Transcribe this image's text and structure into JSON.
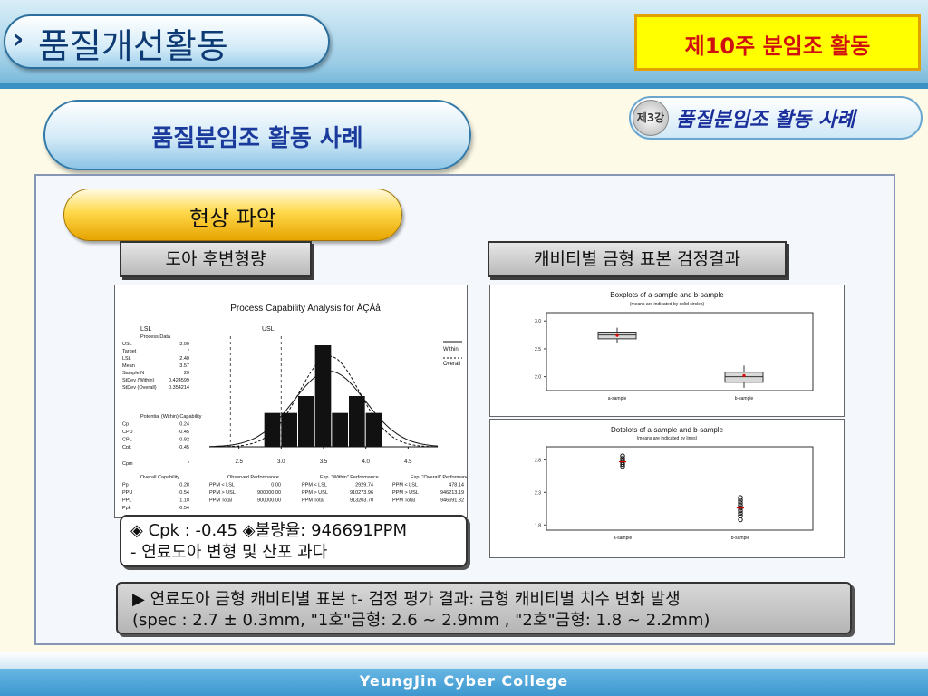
{
  "header": {
    "title": "품질개선활동",
    "week_label": "제10주 분임조 활동"
  },
  "section_title": "품질분임조 활동 사례",
  "lesson": {
    "badge": "제3강",
    "title": "품질분임조 활동 사례"
  },
  "phase_title": "현상 파악",
  "door_label": "도아 후변형량",
  "cavity_label": "캐비티별 금형 표본 검정결과",
  "capability": {
    "title": "Process Capability Analysis for ÀÇÅå",
    "lsl_label": "LSL",
    "usl_label": "USL",
    "legend_within": "Within",
    "legend_overall": "Overall",
    "process_header": "Process Data",
    "process_rows": [
      {
        "k": "USL",
        "v": "3.00"
      },
      {
        "k": "Target",
        "v": "*"
      },
      {
        "k": "LSL",
        "v": "2.40"
      },
      {
        "k": "Mean",
        "v": "3.57"
      },
      {
        "k": "Sample N",
        "v": "20"
      },
      {
        "k": "StDev (Within)",
        "v": "0.424599"
      },
      {
        "k": "StDev (Overall)",
        "v": "0.354214"
      }
    ],
    "potential_header": "Potential (Within) Capability",
    "potential_rows": [
      {
        "k": "Cp",
        "v": "0.24"
      },
      {
        "k": "CPU",
        "v": "-0.45"
      },
      {
        "k": "CPL",
        "v": "0.92"
      },
      {
        "k": "Cpk",
        "v": "-0.45"
      },
      {
        "k": "Cpm",
        "v": "*"
      }
    ],
    "overall_header": "Overall Capability",
    "overall_rows": [
      {
        "k": "Pp",
        "v": "0.28"
      },
      {
        "k": "PPU",
        "v": "-0.54"
      },
      {
        "k": "PPL",
        "v": "1.10"
      },
      {
        "k": "Ppk",
        "v": "-0.54"
      }
    ],
    "observed_header": "Observed Performance",
    "observed_rows": [
      {
        "k": "PPM < LSL",
        "v": "0.00"
      },
      {
        "k": "PPM > USL",
        "v": "900000.00"
      },
      {
        "k": "PPM Total",
        "v": "900000.00"
      }
    ],
    "within_header": "Exp. \"Within\" Performance",
    "within_rows": [
      {
        "k": "PPM < LSL",
        "v": "2929.74"
      },
      {
        "k": "PPM > USL",
        "v": "910273.96"
      },
      {
        "k": "PPM Total",
        "v": "913203.70"
      }
    ],
    "overallperf_header": "Exp. \"Overall\" Performance",
    "overallperf_rows": [
      {
        "k": "PPM < LSL",
        "v": "478.14"
      },
      {
        "k": "PPM > USL",
        "v": "946213.19"
      },
      {
        "k": "PPM Total",
        "v": "946691.32"
      }
    ],
    "x_ticks": [
      "2.5",
      "3.0",
      "3.5",
      "4.0",
      "4.5"
    ]
  },
  "boxplot": {
    "title": "Boxplots of a-sample and b-sample",
    "subtitle": "(means are indicated by solid circles)",
    "y_ticks": [
      "3.0",
      "2.5",
      "2.0"
    ],
    "categories": [
      "a-sample",
      "b-sample"
    ]
  },
  "dotplot": {
    "title": "Dotplots of a-sample and b-sample",
    "subtitle": "(means are indicated by lines)",
    "y_ticks": [
      "2.8",
      "2.3",
      "1.8"
    ],
    "categories": [
      "a-sample",
      "b-sample"
    ]
  },
  "cpk_note": {
    "line1": "◈ Cpk : -0.45  ◈불량율: 946691PPM",
    "line2": "- 연료도아 변형 및 산포 과다"
  },
  "result": {
    "line1": "▶ 연료도아 금형 캐비티별 표본 t- 검정 평가 결과: 금형 캐비티별 치수 변화 발생",
    "line2": "(spec : 2.7 ± 0.3mm, \"1호\"금형: 2.6 ~ 2.9mm , \"2호\"금형: 1.8 ~ 2.2mm)"
  },
  "footer": "YeungJin Cyber College",
  "chart_data": [
    {
      "type": "bar",
      "title": "Process Capability Analysis for ÀÇÅå",
      "x": [
        2.9,
        3.1,
        3.3,
        3.5,
        3.7,
        3.9,
        4.1
      ],
      "values": [
        2,
        2,
        3,
        6,
        2,
        3,
        2
      ],
      "xlim": [
        2.15,
        4.85
      ],
      "lsl": 2.4,
      "usl": 3.0,
      "mean": 3.57,
      "stdev_within": 0.424599,
      "stdev_overall": 0.354214
    },
    {
      "type": "box",
      "title": "Boxplots of a-sample and b-sample",
      "categories": [
        "a-sample",
        "b-sample"
      ],
      "ylim": [
        1.75,
        3.15
      ],
      "boxes": [
        {
          "min": 2.6,
          "q1": 2.68,
          "median": 2.75,
          "q3": 2.8,
          "max": 2.88,
          "mean": 2.74
        },
        {
          "min": 1.8,
          "q1": 1.9,
          "median": 2.0,
          "q3": 2.08,
          "max": 2.2,
          "mean": 2.02
        }
      ]
    },
    {
      "type": "scatter",
      "title": "Dotplots of a-sample and b-sample",
      "categories": [
        "a-sample",
        "b-sample"
      ],
      "ylim": [
        1.72,
        3.0
      ],
      "points": [
        [
          2.86,
          2.82,
          2.79,
          2.76,
          2.73,
          2.7
        ],
        [
          2.22,
          2.18,
          2.14,
          2.1,
          2.06,
          2.02,
          1.98,
          1.94,
          1.88
        ]
      ],
      "means": [
        2.77,
        2.06
      ]
    }
  ]
}
